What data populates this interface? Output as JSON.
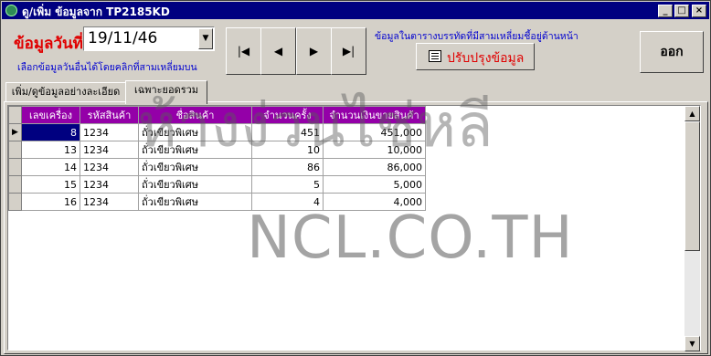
{
  "window": {
    "title": "ดู/เพิ่ม ข้อมูลจาก TP2185KD",
    "controls": {
      "minimize": "_",
      "maximize": "□",
      "close": "×"
    }
  },
  "date_filter": {
    "label": "ข้อมูลวันที่",
    "value": "19/11/46",
    "hint": "เลือกข้อมูลวันอื่นได้โดยคลิกที่สามเหลี่ยมบน"
  },
  "navigation": {
    "first": "|◀",
    "prev": "◀",
    "next": "▶",
    "last": "▶|"
  },
  "info": {
    "text": "ข้อมูลในตารางบรรทัดที่มีสามเหลี่ยมชี้อยู่ด้านหน้า"
  },
  "toolbar": {
    "refresh_label": "ปรับปรุงข้อมูล",
    "refresh_icon": "form-icon",
    "exit_label": "ออก"
  },
  "tabs": [
    {
      "label": "เพิ่ม/ดูข้อมูลอย่างละเอียด",
      "active": false
    },
    {
      "label": "เฉพาะยอดรวม",
      "active": true
    }
  ],
  "grid": {
    "columns": [
      "เลขเครื่อง",
      "รหัสสินค้า",
      "ชื่อสินค้า",
      "จำนวนครั้ง",
      "จำนวนเงินขายสินค้า"
    ],
    "current_row_indicator": "▶",
    "rows": [
      [
        "8",
        "1234",
        "ถั่วเขียวพิเศษ",
        "451",
        "451,000"
      ],
      [
        "13",
        "1234",
        "ถั่วเขียวพิเศษ",
        "10",
        "10,000"
      ],
      [
        "14",
        "1234",
        "ถั่วเขียวพิเศษ",
        "86",
        "86,000"
      ],
      [
        "15",
        "1234",
        "ถั่วเขียวพิเศษ",
        "5",
        "5,000"
      ],
      [
        "16",
        "1234",
        "ถั่วเขียวพิเศษ",
        "4",
        "4,000"
      ]
    ]
  },
  "scrollbar": {
    "up": "▲",
    "down": "▼"
  },
  "watermark": {
    "thai": "ห้างง่วนไช่หลี",
    "domain": "NCL.CO.TH"
  }
}
